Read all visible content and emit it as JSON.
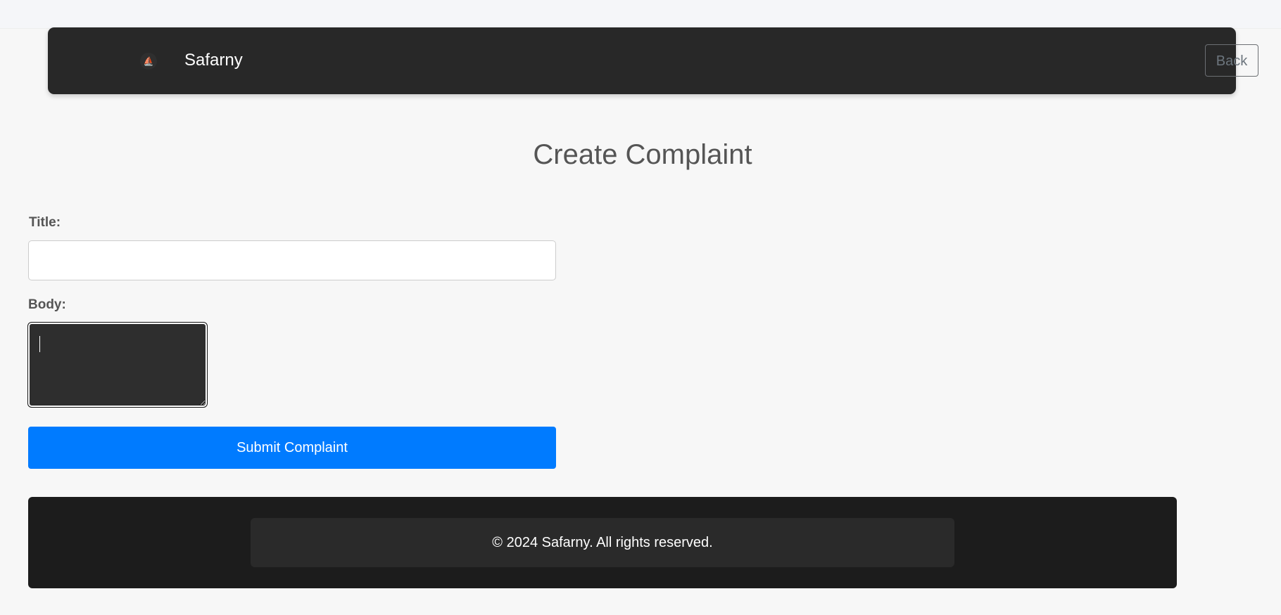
{
  "navbar": {
    "logo_icon": "logo-icon",
    "logo_glyph": "⛵",
    "brand": "Safarny",
    "back_label": "Back"
  },
  "page": {
    "title": "Create Complaint"
  },
  "form": {
    "title_label": "Title:",
    "title_value": "",
    "body_label": "Body:",
    "body_value": "",
    "submit_label": "Submit Complaint"
  },
  "footer": {
    "copyright": "© 2024 Safarny. All rights reserved."
  },
  "colors": {
    "navbar_bg": "#282828",
    "primary_button": "#007bff",
    "footer_bg": "#1c1c1c",
    "textarea_bg": "#2e2e2e"
  }
}
